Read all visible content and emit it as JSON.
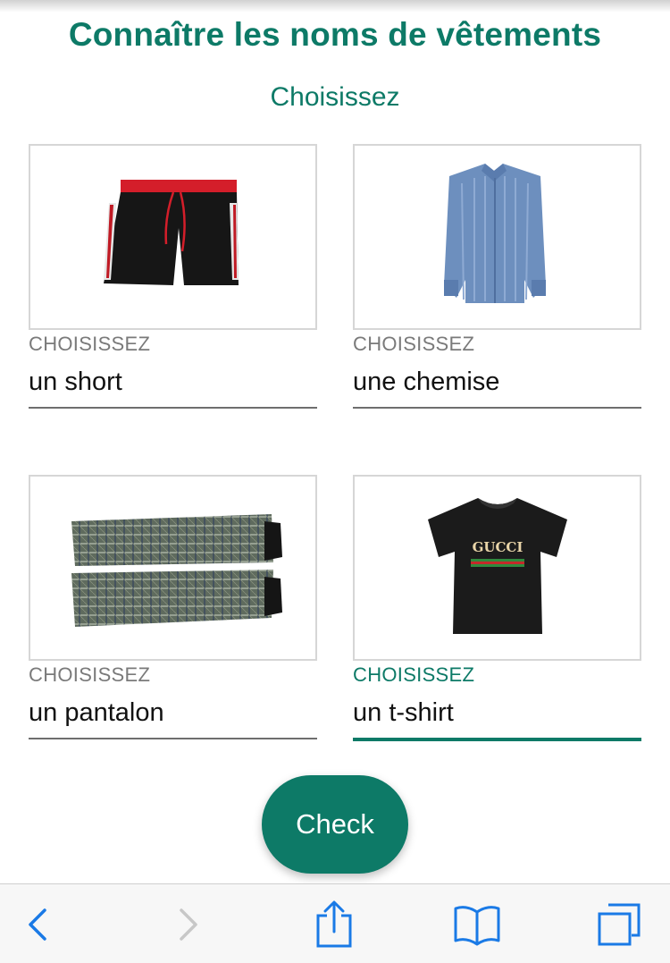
{
  "title": "Connaître les noms de vêtements",
  "subtitle": "Choisissez",
  "items": [
    {
      "label": "CHOISISSEZ",
      "value": "un short",
      "image": "black-shorts-image",
      "active": false
    },
    {
      "label": "CHOISISSEZ",
      "value": "une chemise",
      "image": "blue-shirt-image",
      "active": false
    },
    {
      "label": "CHOISISSEZ",
      "value": "un pantalon",
      "image": "plaid-trousers-image",
      "active": false
    },
    {
      "label": "CHOISISSEZ",
      "value": "un t-shirt",
      "image": "black-tshirt-image",
      "active": true
    }
  ],
  "tshirt_logo": "GUCCI",
  "check_button": {
    "label": "Check"
  },
  "toolbar": {
    "icons": [
      "back-arrow-icon",
      "forward-arrow-icon",
      "share-icon",
      "bookmarks-icon",
      "tabs-icon"
    ]
  },
  "colors": {
    "accent": "#0d7a67",
    "toolbar_icon": "#1a7ae6",
    "toolbar_icon_disabled": "#c7c7c7"
  }
}
